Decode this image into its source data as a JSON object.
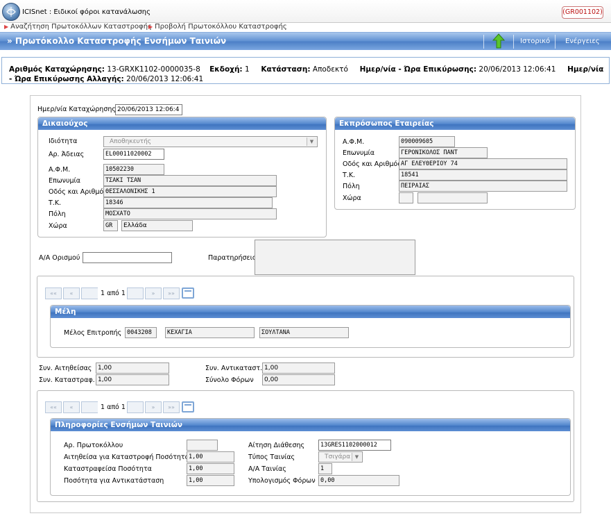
{
  "app": {
    "title": "ICISnet : Ειδικοί φόροι κατανάλωσης",
    "code": "(GR001102)"
  },
  "breadcrumb": [
    "Αναζήτηση Πρωτοκόλλων Καταστροφής",
    "Προβολή Πρωτοκόλλου Καταστροφής"
  ],
  "header": {
    "title": "» Πρωτόκολλο Καταστροφής Ενσήμων Ταινιών",
    "history": "Ιστορικό",
    "actions": "Ενέργειες"
  },
  "info": {
    "reg_label": "Αριθμός Καταχώρησης:",
    "reg_value": "13-GRXK1102-0000035-8",
    "ver_label": "Εκδοχή:",
    "ver_value": "1",
    "status_label": "Κατάσταση:",
    "status_value": "Αποδεκτό",
    "conf_label": "Ημερ/νία - Ώρα Επικύρωσης:",
    "conf_value": "20/06/2013 12:06:41",
    "change_label_a": "Ημερ/νία",
    "change_label_b": "- Ώρα Επικύρωσης Αλλαγής:",
    "change_value": "20/06/2013 12:06:41"
  },
  "form": {
    "reg_date_label": "Ημερ/νία Καταχώρησης",
    "reg_date_value": "20/06/2013 12:06:4",
    "beneficiary": {
      "title": "Δικαιούχος",
      "capacity_label": "Ιδιότητα",
      "capacity_value": "Αποθηκευτής",
      "license_label": "Αρ. Άδειας",
      "license_value": "EL00011020002",
      "afm_label": "Α.Φ.Μ.",
      "afm_value": "10502230",
      "name_label": "Επωνυμία",
      "name_value": "ΤΣΑΚΙ  ΤΣΑΝ",
      "street_label": "Οδός και Αριθμός",
      "street_value": "ΘΕΣΣΑΛΟΝΙΚΗΣ 1",
      "zip_label": "Τ.Κ.",
      "zip_value": "18346",
      "city_label": "Πόλη",
      "city_value": "ΜΟΣΧΑΤΟ",
      "country_label": "Χώρα",
      "country_code": "GR",
      "country_name": "Ελλάδα"
    },
    "representative": {
      "title": "Εκπρόσωπος Εταιρείας",
      "afm_label": "Α.Φ.Μ.",
      "afm_value": "090009605",
      "name_label": "Επωνυμία",
      "name_value": "ΓΕΡΟΝΙΚΟΛΟΣ ΠΑΝΤ",
      "street_label": "Οδός και Αριθμός",
      "street_value": "ΑΓ ΕΛΕΥΘΕΡΙΟΥ 74",
      "zip_label": "Τ.Κ.",
      "zip_value": "18541",
      "city_label": "Πόλη",
      "city_value": "ΠΕΙΡΑΙΑΣ",
      "country_label": "Χώρα",
      "country_code": "",
      "country_name": ""
    },
    "aa_label": "Α/Α Ορισμού",
    "aa_value": "",
    "notes_label": "Παρατηρήσεις",
    "notes_value": "",
    "pager1": {
      "first": "««",
      "prev": "«",
      "text": "1 από 1",
      "next": "»",
      "last": "»»"
    },
    "members": {
      "title": "Μέλη",
      "member_label": "Μέλος Επιτροπής",
      "member_code": "0043208",
      "member_last": "ΚΕΧΑΓΙΑ",
      "member_first": "ΣΟΥΛΤΑΝΑ"
    },
    "coef_requested_label": "Συν. Αιτηθείσας",
    "coef_requested_value": "1,00",
    "coef_destroyed_label": "Συν. Καταστραφ.",
    "coef_destroyed_value": "1,00",
    "coef_replace_label": "Συν. Αντικαταστ.",
    "coef_replace_value": "1,00",
    "tax_total_label": "Σύνολο Φόρων",
    "tax_total_value": "0,00",
    "pager2": {
      "first": "««",
      "prev": "«",
      "text": "1 από 1",
      "next": "»",
      "last": "»»"
    },
    "stamps": {
      "title": "Πληροφορίες Ενσήμων Ταινιών",
      "protocol_label": "Αρ. Πρωτοκόλλου",
      "protocol_value": "",
      "request_label": "Αίτηση Διάθεσης",
      "request_value": "13GRES1102000012",
      "req_qty_label": "Αιτηθείσα για Καταστροφή Ποσότητα",
      "req_qty_value": "1,00",
      "type_label": "Τύπος Ταινίας",
      "type_value": "Τσιγάρα",
      "destroyed_qty_label": "Καταστραφείσα Ποσότητα",
      "destroyed_qty_value": "1,00",
      "aa_label": "Α/Α Ταινίας",
      "aa_value": "1",
      "replace_qty_label": "Ποσότητα για Αντικατάσταση",
      "replace_qty_value": "1,00",
      "tax_calc_label": "Υπολογισμός Φόρων",
      "tax_calc_value": "0,00"
    }
  }
}
